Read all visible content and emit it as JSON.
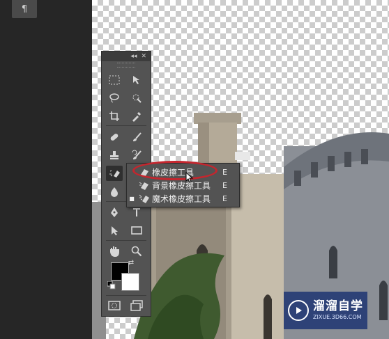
{
  "paragraph_button": {
    "label": "¶"
  },
  "tools_panel": {
    "header": {
      "collapse_label": "◂◂",
      "close_label": "✕"
    },
    "tools": [
      {
        "icon": "rectangular-marquee-icon"
      },
      {
        "icon": "move-icon"
      },
      {
        "icon": "lasso-icon"
      },
      {
        "icon": "quick-selection-icon"
      },
      {
        "icon": "crop-icon"
      },
      {
        "icon": "eyedropper-icon"
      },
      {
        "icon": "spot-healing-brush-icon"
      },
      {
        "icon": "brush-icon"
      },
      {
        "icon": "clone-stamp-icon"
      },
      {
        "icon": "history-brush-icon"
      },
      {
        "icon": "eraser-icon",
        "active": true
      },
      {
        "icon": "blur-icon"
      },
      {
        "icon": "pen-icon"
      },
      {
        "icon": "type-icon"
      },
      {
        "icon": "path-selection-icon"
      },
      {
        "icon": "rectangle-shape-icon"
      },
      {
        "icon": "hand-icon"
      },
      {
        "icon": "zoom-icon"
      },
      {
        "icon": "quick-mask-icon"
      },
      {
        "icon": "screen-mode-icon"
      }
    ],
    "colors": {
      "foreground": "#000000",
      "background": "#ffffff"
    }
  },
  "flyout": {
    "items": [
      {
        "label": "橡皮擦工具",
        "shortcut": "E",
        "icon": "eraser-icon",
        "highlighted": true
      },
      {
        "label": "背景橡皮擦工具",
        "shortcut": "E",
        "icon": "background-eraser-icon"
      },
      {
        "label": "魔术橡皮擦工具",
        "shortcut": "E",
        "icon": "magic-eraser-icon",
        "selected": true
      }
    ],
    "selected_marker": "■"
  },
  "watermark": {
    "title": "溜溜自学",
    "url": "ZIXUE.3D66.COM"
  },
  "colors": {
    "accent_oval": "#c4262e",
    "panel": "#535353",
    "watermark_bg": "#142d6e"
  }
}
